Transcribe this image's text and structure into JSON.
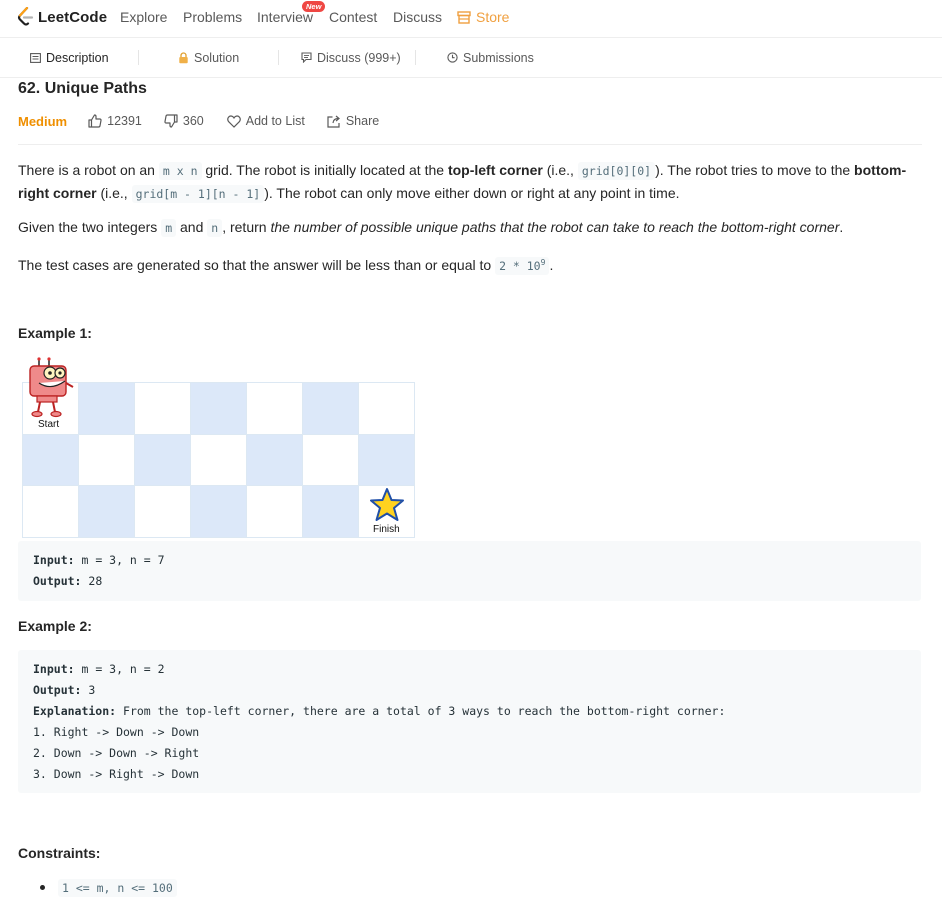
{
  "nav": {
    "logo_text": "LeetCode",
    "items": [
      "Explore",
      "Problems",
      "Interview",
      "Contest",
      "Discuss"
    ],
    "new_badge": "New",
    "store": "Store"
  },
  "tabs": {
    "description": "Description",
    "solution": "Solution",
    "discuss": "Discuss (999+)",
    "submissions": "Submissions"
  },
  "problem": {
    "title": "62. Unique Paths",
    "difficulty": "Medium",
    "likes": "12391",
    "dislikes": "360",
    "add_to_list": "Add to List",
    "share": "Share"
  },
  "description": {
    "p1": {
      "a": "There is a robot on an ",
      "code1": "m x n",
      "b": " grid. The robot is initially located at the ",
      "bold1": "top-left corner",
      "c": " (i.e., ",
      "code2": "grid[0][0]",
      "d": "). The robot tries to move to the ",
      "bold2": "bottom-right corner",
      "e": " (i.e., ",
      "code3": "grid[m - 1][n - 1]",
      "f": "). The robot can only move either down or right at any point in time."
    },
    "p2": {
      "a": "Given the two integers ",
      "code1": "m",
      "b": " and ",
      "code2": "n",
      "c": ", return ",
      "italic": "the number of possible unique paths that the robot can take to reach the bottom-right corner",
      "d": "."
    },
    "p3": {
      "a": "The test cases are generated so that the answer will be less than or equal to ",
      "code": "2 * 10",
      "sup": "9",
      "b": "."
    }
  },
  "example1": {
    "heading": "Example 1:",
    "start_label": "Start",
    "finish_label": "Finish",
    "input_label": "Input:",
    "input_value": " m = 3, n = 7",
    "output_label": "Output:",
    "output_value": " 28"
  },
  "example2": {
    "heading": "Example 2:",
    "input_label": "Input:",
    "input_value": " m = 3, n = 2",
    "output_label": "Output:",
    "output_value": " 3",
    "explanation_label": "Explanation:",
    "explanation_value": " From the top-left corner, there are a total of 3 ways to reach the bottom-right corner:",
    "lines": [
      "1. Right -> Down -> Down",
      "2. Down -> Down -> Right",
      "3. Down -> Right -> Down"
    ]
  },
  "constraints": {
    "heading": "Constraints:",
    "items": [
      "1 <= m, n <= 100"
    ]
  },
  "colors": {
    "difficulty": "#ef8f00",
    "store": "#f0a040",
    "badge": "#ef4743",
    "grid_blue": "#dce8f9"
  },
  "grid": {
    "rows": 3,
    "cols": 7
  }
}
